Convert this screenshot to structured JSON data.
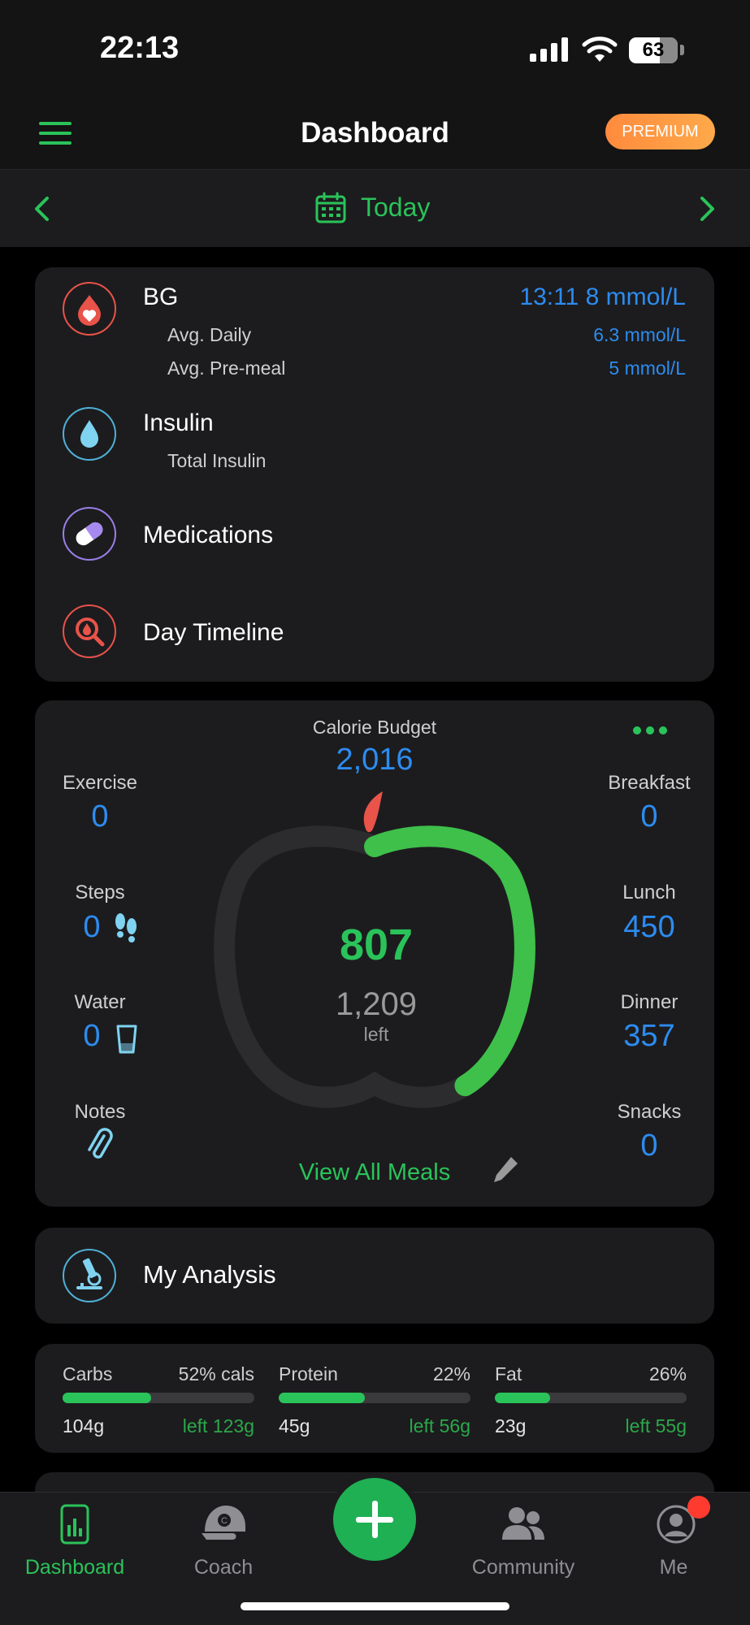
{
  "status": {
    "time": "22:13",
    "battery": "63"
  },
  "header": {
    "title": "Dashboard",
    "premium_label": "PREMIUM"
  },
  "datebar": {
    "label": "Today"
  },
  "health": {
    "bg": {
      "title": "BG",
      "latest": "13:11 8 mmol/L",
      "avg_daily_label": "Avg. Daily",
      "avg_daily_value": "6.3 mmol/L",
      "avg_premeal_label": "Avg. Pre-meal",
      "avg_premeal_value": "5 mmol/L"
    },
    "insulin": {
      "title": "Insulin",
      "total_label": "Total Insulin"
    },
    "medications": {
      "title": "Medications"
    },
    "timeline": {
      "title": "Day Timeline"
    }
  },
  "calories": {
    "budget_label": "Calorie Budget",
    "budget_value": "2,016",
    "consumed": "807",
    "left_value": "1,209",
    "left_label": "left",
    "progress_fraction": 0.4,
    "exercise": {
      "label": "Exercise",
      "value": "0"
    },
    "steps": {
      "label": "Steps",
      "value": "0"
    },
    "water": {
      "label": "Water",
      "value": "0"
    },
    "notes": {
      "label": "Notes"
    },
    "breakfast": {
      "label": "Breakfast",
      "value": "0"
    },
    "lunch": {
      "label": "Lunch",
      "value": "450"
    },
    "dinner": {
      "label": "Dinner",
      "value": "357"
    },
    "snacks": {
      "label": "Snacks",
      "value": "0"
    },
    "view_all": "View All Meals"
  },
  "analysis": {
    "title": "My Analysis"
  },
  "macros": [
    {
      "name": "Carbs",
      "pct": "52% cals",
      "amount": "104g",
      "left": "left 123g",
      "fill": 0.46
    },
    {
      "name": "Protein",
      "pct": "22%",
      "amount": "45g",
      "left": "left 56g",
      "fill": 0.45
    },
    {
      "name": "Fat",
      "pct": "26%",
      "amount": "23g",
      "left": "left 55g",
      "fill": 0.29
    }
  ],
  "tabs": {
    "dashboard": "Dashboard",
    "coach": "Coach",
    "community": "Community",
    "me": "Me"
  },
  "colors": {
    "accent": "#2ac35a",
    "value_blue": "#2d8cf0",
    "premium": "#ff9a44",
    "bg_icon": "#e8534a",
    "insulin_icon": "#7fd3f0",
    "med_icon": "#a68af0"
  }
}
